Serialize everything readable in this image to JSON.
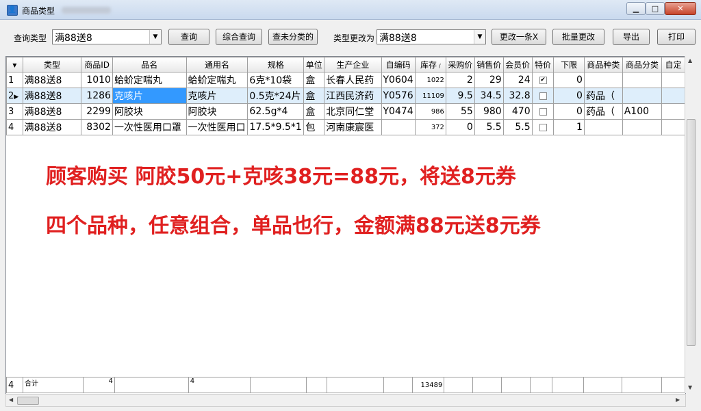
{
  "window": {
    "title": "商品类型",
    "icon": "app-icon",
    "controls": {
      "minimize": "▁",
      "maximize": "□",
      "close": "✕"
    }
  },
  "toolbar": {
    "query_type_label": "查询类型",
    "query_type_value": "满88送8",
    "query_button": "查询",
    "combined_query_button": "综合查询",
    "uncategorized_button": "查未分类的",
    "change_type_label": "类型更改为",
    "change_type_value": "满88送8",
    "change_one_button": "更改一条X",
    "batch_change_button": "批量更改",
    "export_button": "导出",
    "print_button": "打印"
  },
  "grid": {
    "columns": [
      "",
      "类型",
      "商品ID",
      "品名",
      "通用名",
      "规格",
      "单位",
      "生产企业",
      "自编码",
      "库存",
      "采购价",
      "销售价",
      "会员价",
      "特价",
      "下限",
      "商品种类",
      "商品分类",
      "自定"
    ],
    "sort_indicator_column": "库存",
    "rows": [
      {
        "no": "1",
        "type": "满88送8",
        "id": "1010",
        "name": "蛤蚧定喘丸",
        "generic": "蛤蚧定喘丸",
        "spec": "6克*10袋",
        "unit": "盒",
        "maker": "长春人民药",
        "code": "Y0604",
        "stock": "1022",
        "purchase": "2",
        "sale": "29",
        "member": "24",
        "special": true,
        "lower": "0",
        "kind": "",
        "category": ""
      },
      {
        "no": "2",
        "type": "满88送8",
        "id": "1286",
        "name": "克咳片",
        "generic": "克咳片",
        "spec": "0.5克*24片",
        "unit": "盒",
        "maker": "江西民济药",
        "code": "Y0576",
        "stock": "11109",
        "purchase": "9.5",
        "sale": "34.5",
        "member": "32.8",
        "special": false,
        "lower": "0",
        "kind": "药品（",
        "category": ""
      },
      {
        "no": "3",
        "type": "满88送8",
        "id": "2299",
        "name": "阿胶块",
        "generic": "阿胶块",
        "spec": "62.5g*4",
        "unit": "盒",
        "maker": "北京同仁堂",
        "code": "Y0474",
        "stock": "986",
        "purchase": "55",
        "sale": "980",
        "member": "470",
        "special": false,
        "lower": "0",
        "kind": "药品（",
        "category": "A100"
      },
      {
        "no": "4",
        "type": "满88送8",
        "id": "8302",
        "name": "一次性医用口罩",
        "generic": "一次性医用口",
        "spec": "17.5*9.5*1",
        "unit": "包",
        "maker": "河南康宸医",
        "code": "",
        "stock": "372",
        "purchase": "0",
        "sale": "5.5",
        "member": "5.5",
        "special": false,
        "lower": "1",
        "kind": "",
        "category": ""
      }
    ],
    "current_row_indicator": "▶",
    "footer": {
      "count": "4",
      "total_label": "合计",
      "id_count": "4",
      "generic_count": "4",
      "stock_total": "13489"
    }
  },
  "annotation": {
    "line1": "顾客购买  阿胶50元+克咳38元=88元，将送8元券",
    "line2": "四个品种，任意组合，单品也行，金额满88元送8元券",
    "color": "#e02020"
  },
  "colors": {
    "selected_cell": "#3399ff",
    "alt_row": "#deeefb"
  }
}
